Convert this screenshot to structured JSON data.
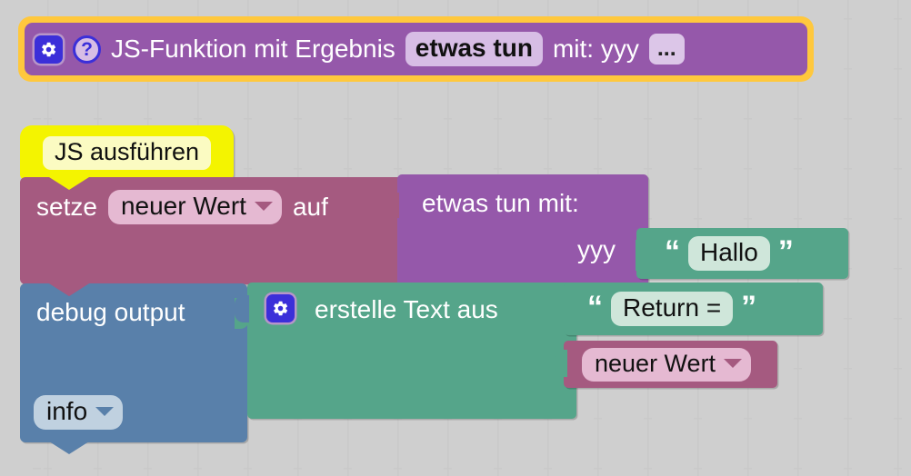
{
  "editor": {
    "background_color": "#ffffff",
    "grid_color": "#c9c9c9"
  },
  "definition_block": {
    "name": "js-function-definition",
    "selected": true,
    "highlight_color": "#ffc83d",
    "block_color": "#9558aa",
    "gear_icon": "gear-icon",
    "help_icon": "help-icon",
    "help_label": "?",
    "label_prefix": "JS-Funktion mit Ergebnis",
    "function_name": "etwas tun",
    "label_mid": "mit: yyy",
    "ellipsis": "..."
  },
  "hat_block": {
    "name": "js-ausfuehren-hat",
    "color": "#f4f400",
    "field_color": "#fbfbc2",
    "label": "JS ausführen"
  },
  "setze_block": {
    "name": "set-variable-statement",
    "color": "#a55a80",
    "label_prefix": "setze",
    "variable": "neuer Wert",
    "label_suffix": "auf"
  },
  "call_block": {
    "name": "call-etwas-tun",
    "color": "#9558aa",
    "label_top": "etwas tun  mit:",
    "param_label": "yyy"
  },
  "hallo_string": {
    "name": "string-literal-hallo",
    "color": "#55a58a",
    "quote_open": "“",
    "quote_close": "”",
    "value": "Hallo"
  },
  "debug_block": {
    "name": "debug-output-statement",
    "color": "#5980aa",
    "label": "debug output",
    "level": "info"
  },
  "join_block": {
    "name": "create-text-from",
    "color": "#55a58a",
    "gear_icon": "gear-icon",
    "label": "erstelle Text aus"
  },
  "return_string": {
    "name": "string-literal-return",
    "color": "#55a58a",
    "quote_open": "“",
    "quote_close": "”",
    "value": "Return ="
  },
  "neuer_wert_var": {
    "name": "variable-neuer-wert",
    "color": "#a55a80",
    "variable": "neuer Wert"
  }
}
